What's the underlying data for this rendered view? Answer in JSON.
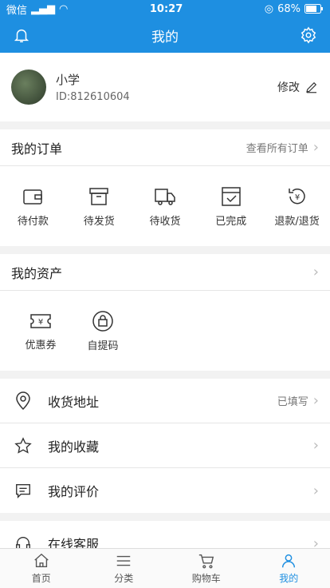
{
  "status_bar": {
    "carrier": "微信",
    "time": "10:27",
    "battery": "68%"
  },
  "header": {
    "title": "我的"
  },
  "profile": {
    "name": "小学",
    "id": "ID:812610604",
    "edit_label": "修改"
  },
  "orders": {
    "title": "我的订单",
    "more": "查看所有订单",
    "items": [
      {
        "label": "待付款",
        "icon": "wallet-icon"
      },
      {
        "label": "待发货",
        "icon": "box-icon"
      },
      {
        "label": "待收货",
        "icon": "truck-icon"
      },
      {
        "label": "已完成",
        "icon": "check-box-icon"
      },
      {
        "label": "退款/退货",
        "icon": "refund-icon"
      }
    ]
  },
  "assets": {
    "title": "我的资产",
    "items": [
      {
        "label": "优惠券",
        "icon": "coupon-icon"
      },
      {
        "label": "自提码",
        "icon": "bag-icon"
      }
    ]
  },
  "menu": [
    {
      "label": "收货地址",
      "value": "已填写",
      "icon": "location-icon"
    },
    {
      "label": "我的收藏",
      "value": "",
      "icon": "star-icon"
    },
    {
      "label": "我的评价",
      "value": "",
      "icon": "comment-icon"
    },
    {
      "label": "在线客服",
      "value": "",
      "icon": "headset-icon"
    }
  ],
  "tabbar": [
    {
      "label": "首页",
      "icon": "home-icon"
    },
    {
      "label": "分类",
      "icon": "list-icon"
    },
    {
      "label": "购物车",
      "icon": "cart-icon"
    },
    {
      "label": "我的",
      "icon": "user-icon",
      "active": true
    }
  ],
  "colors": {
    "primary": "#1e8fe1"
  }
}
